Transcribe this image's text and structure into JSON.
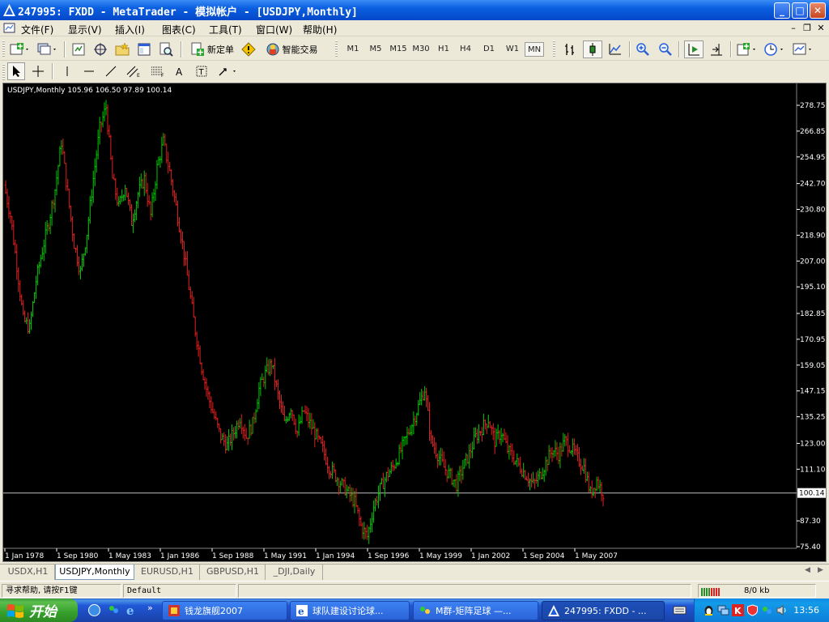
{
  "window": {
    "title": "247995: FXDD - MetaTrader - 模拟帐户 - [USDJPY,Monthly]",
    "buttons": [
      "minimize",
      "maximize",
      "close"
    ]
  },
  "menu": {
    "items": [
      "文件(F)",
      "显示(V)",
      "插入(I)",
      "图表(C)",
      "工具(T)",
      "窗口(W)",
      "帮助(H)"
    ]
  },
  "toolbar": {
    "new_order_label": "新定单",
    "expert_label": "智能交易",
    "timeframes": [
      "M1",
      "M5",
      "M15",
      "M30",
      "H1",
      "H4",
      "D1",
      "W1",
      "MN"
    ],
    "active_timeframe": "MN"
  },
  "chart": {
    "info": "USDJPY,Monthly  105.96 106.50 97.89 100.14",
    "current_price": "100.14"
  },
  "chart_data": {
    "type": "bar",
    "symbol": "USDJPY",
    "timeframe": "Monthly",
    "ohlc_last": {
      "open": 105.96,
      "high": 106.5,
      "low": 97.89,
      "close": 100.14
    },
    "y_ticks": [
      278.75,
      266.85,
      254.95,
      242.7,
      230.8,
      218.9,
      207.0,
      195.1,
      182.85,
      170.95,
      159.05,
      147.15,
      135.25,
      123.0,
      111.1,
      87.3,
      75.4
    ],
    "ylim": [
      75.4,
      278.75
    ],
    "x_ticks": [
      "1 Jan 1978",
      "1 Sep 1980",
      "1 May 1983",
      "1 Jan 1986",
      "1 Sep 1988",
      "1 May 1991",
      "1 Jan 1994",
      "1 Sep 1996",
      "1 May 1999",
      "1 Jan 2002",
      "1 Sep 2004",
      "1 May 2007"
    ],
    "price_line": 100.14,
    "colors": {
      "up": "#00c800",
      "down": "#e02020",
      "background": "#000000",
      "text": "#ffffff",
      "price_line": "#c0c0c0"
    },
    "series": [
      {
        "values": [
          242,
          228,
          205,
          180,
          176,
          198,
          212,
          225,
          240,
          262,
          238,
          215,
          202,
          220,
          245,
          268,
          278,
          245,
          232,
          242,
          225,
          238,
          245,
          228,
          250,
          262,
          248,
          232,
          215,
          195,
          175,
          158,
          145,
          135,
          126,
          122,
          128,
          135,
          126,
          132,
          148,
          155,
          160,
          145,
          132,
          140,
          128,
          138,
          132,
          126,
          120,
          112,
          108,
          104,
          100,
          96,
          85,
          80,
          94,
          102,
          108,
          112,
          118,
          125,
          132,
          140,
          148,
          124,
          118,
          112,
          108,
          104,
          112,
          118,
          126,
          130,
          134,
          124,
          128,
          120,
          116,
          112,
          108,
          104,
          108,
          114,
          120,
          118,
          124,
          121,
          116,
          112,
          100,
          106,
          100
        ]
      }
    ]
  },
  "tabs": {
    "items": [
      "USDX,H1",
      "USDJPY,Monthly",
      "EURUSD,H1",
      "GBPUSD,H1",
      "_DJI,Daily"
    ],
    "active": "USDJPY,Monthly"
  },
  "status": {
    "help": "寻求帮助, 请按F1键",
    "profile": "Default",
    "traffic": "8/0 kb"
  },
  "taskbar": {
    "start_label": "开始",
    "tasks": [
      "钱龙旗舰2007",
      "球队建设讨论球...",
      "M群-矩阵足球 —...",
      "247995: FXDD - ..."
    ],
    "clock": "13:56"
  }
}
